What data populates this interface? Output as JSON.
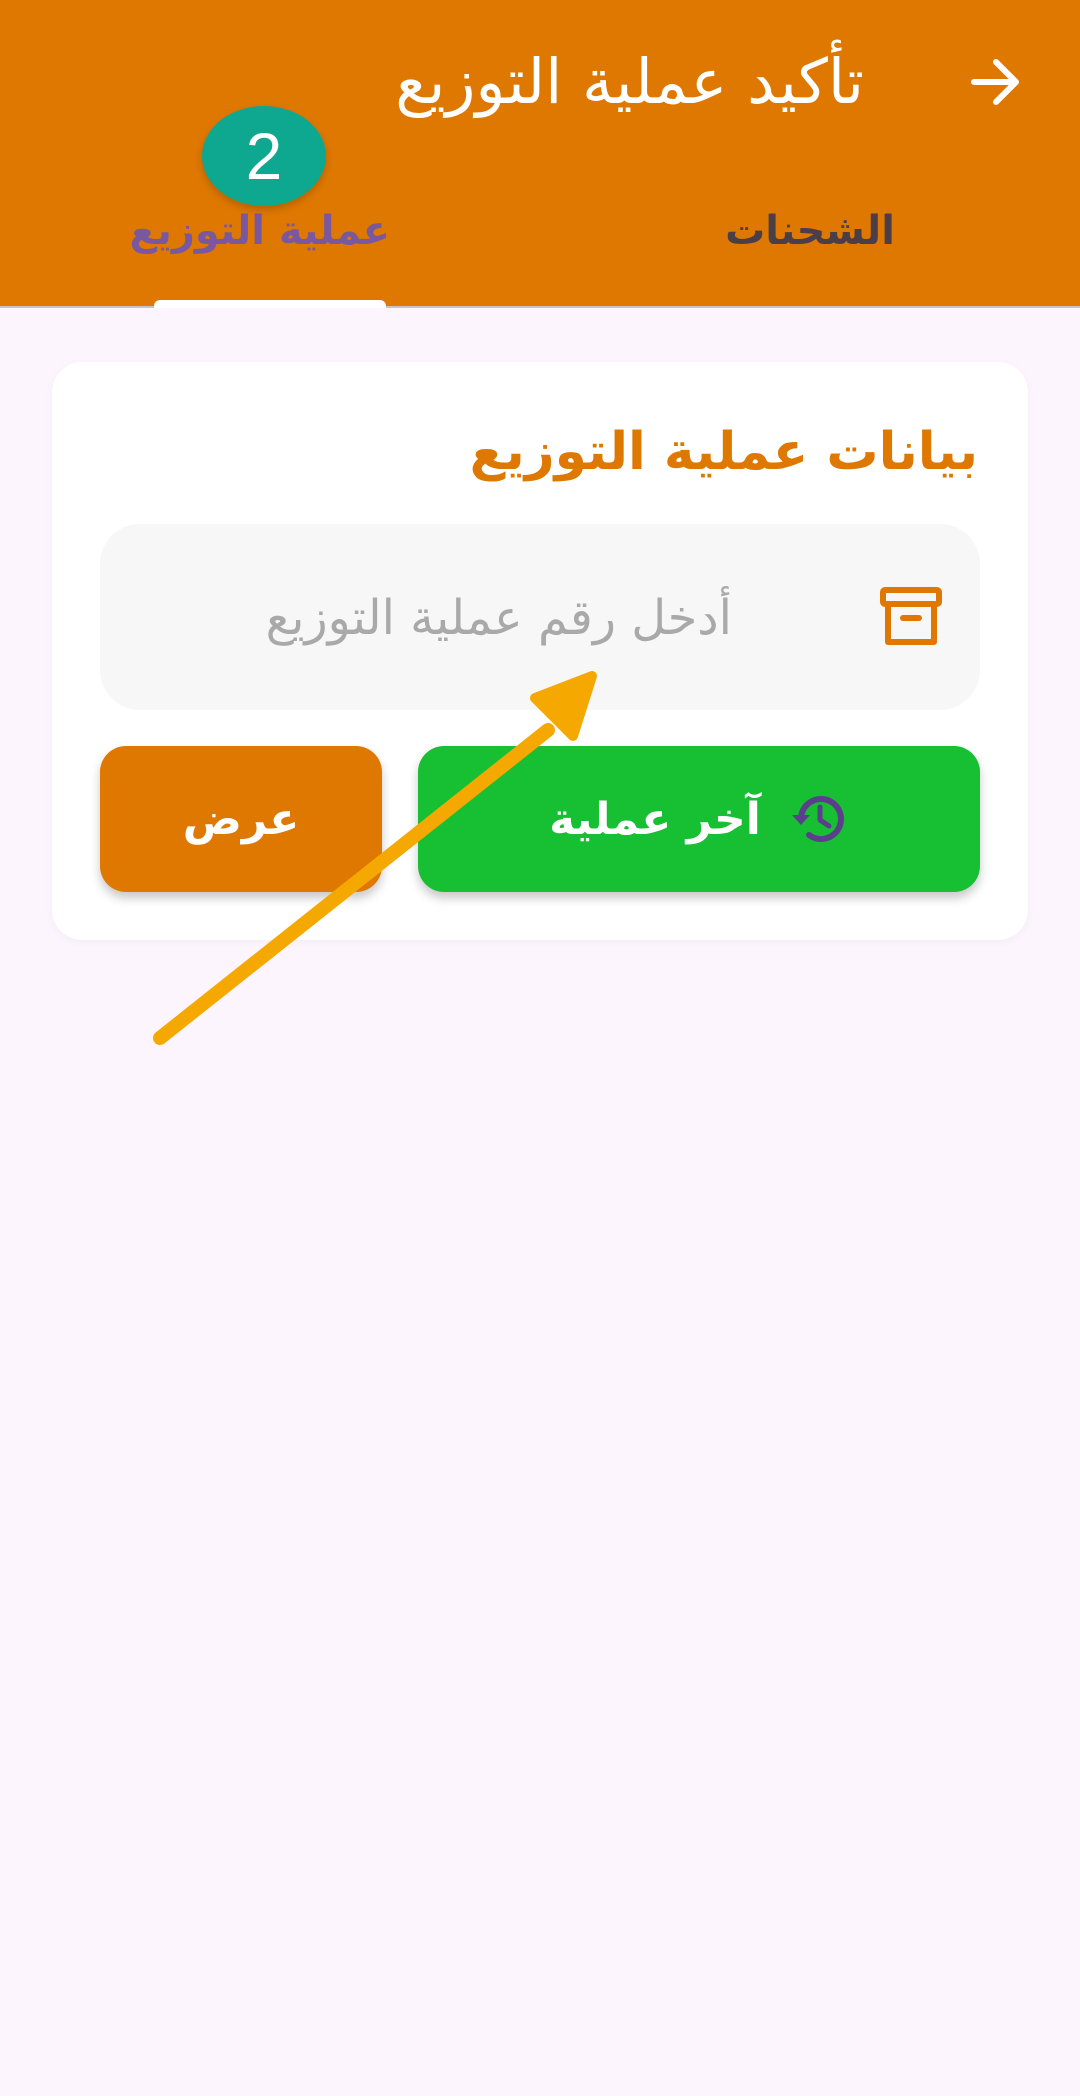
{
  "header": {
    "title": "تأكيد عملية التوزيع",
    "back_icon": "arrow-forward-icon",
    "tabs": [
      {
        "label": "الشحنات",
        "selected": false
      },
      {
        "label": "عملية التوزيع",
        "selected": true
      }
    ],
    "step_badge": "2"
  },
  "card": {
    "title": "بيانات عملية التوزيع",
    "input": {
      "placeholder": "أدخل رقم عملية التوزيع",
      "value": "",
      "icon": "archive-box-icon"
    },
    "buttons": {
      "last_operation": {
        "label": "آخر عملية",
        "icon": "history-icon"
      },
      "show": {
        "label": "عرض"
      }
    }
  },
  "colors": {
    "primary": "#df7800",
    "success": "#17bf32",
    "badge": "#0ea890",
    "background": "#fcf5fd",
    "annotation_arrow": "#f5a800"
  }
}
